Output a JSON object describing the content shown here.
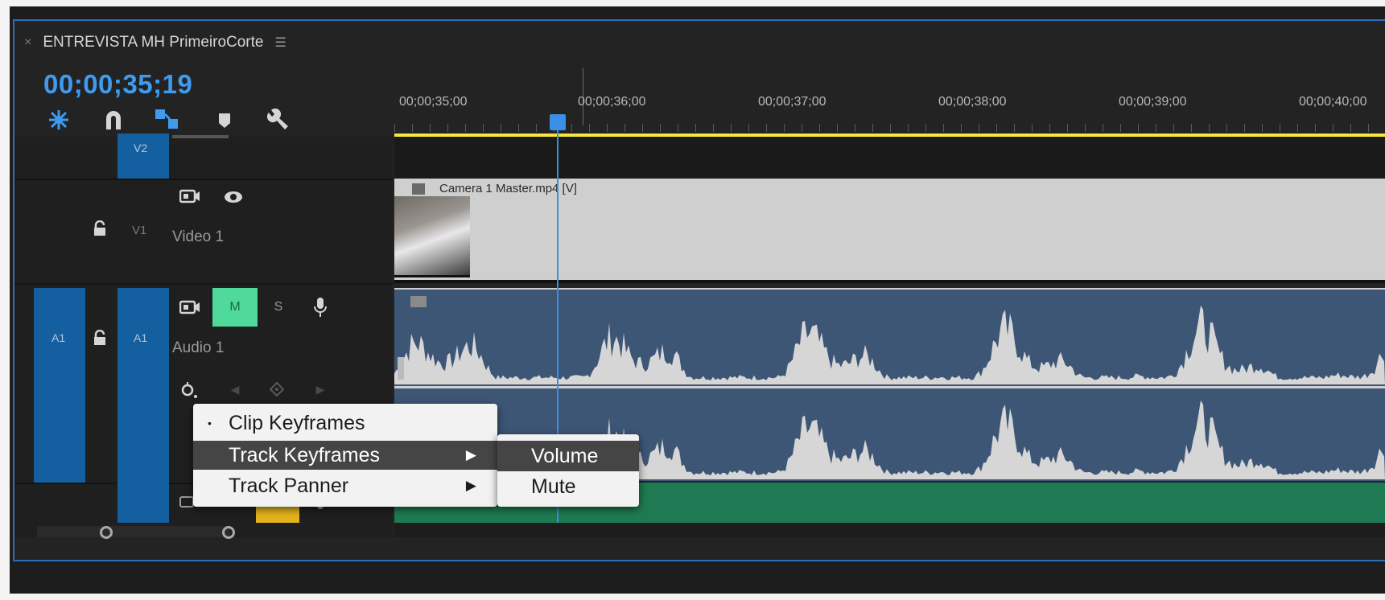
{
  "sequence": {
    "tab_close": "×",
    "name": "ENTREVISTA MH PrimeiroCorte",
    "menu_icon": "☰",
    "timecode": "00;00;35;19"
  },
  "toolbar": {
    "icons": [
      "nest-icon",
      "snap-magnet-icon",
      "linked-selection-icon",
      "add-marker-icon",
      "wrench-settings-icon"
    ]
  },
  "ruler": {
    "ticks": [
      "00;00;35;00",
      "00;00;36;00",
      "00;00;37;00",
      "00;00;38;00",
      "00;00;39;00",
      "00;00;40;00"
    ]
  },
  "tracks": {
    "v2": {
      "target_label": "V2"
    },
    "v1": {
      "source_label": "V1",
      "name": "Video 1",
      "eye_icon": "eye-icon"
    },
    "a1": {
      "source_label": "A1",
      "target_label": "A1",
      "name": "Audio 1",
      "mute": "M",
      "solo": "S"
    }
  },
  "clips": {
    "video": {
      "name": "Camera 1 Master.mp4 [V]"
    }
  },
  "context_menu": {
    "items": [
      {
        "label": "Clip Keyframes",
        "checked": true,
        "has_submenu": false
      },
      {
        "label": "Track Keyframes",
        "checked": false,
        "has_submenu": true,
        "highlighted": true
      },
      {
        "label": "Track Panner",
        "checked": false,
        "has_submenu": true
      }
    ],
    "submenu": [
      {
        "label": "Volume",
        "highlighted": true
      },
      {
        "label": "Mute"
      }
    ],
    "bullet": "•",
    "arrow": "▶"
  },
  "colors": {
    "timecode": "#3e9bf0",
    "patch": "#145f9f",
    "mute_active": "#4fd99a",
    "voice_button": "#e2b21c",
    "work_area": "#f6e83a",
    "playhead": "#3a8fe6",
    "audio_clip": "#3e5676",
    "green_track": "#1e7a52"
  }
}
